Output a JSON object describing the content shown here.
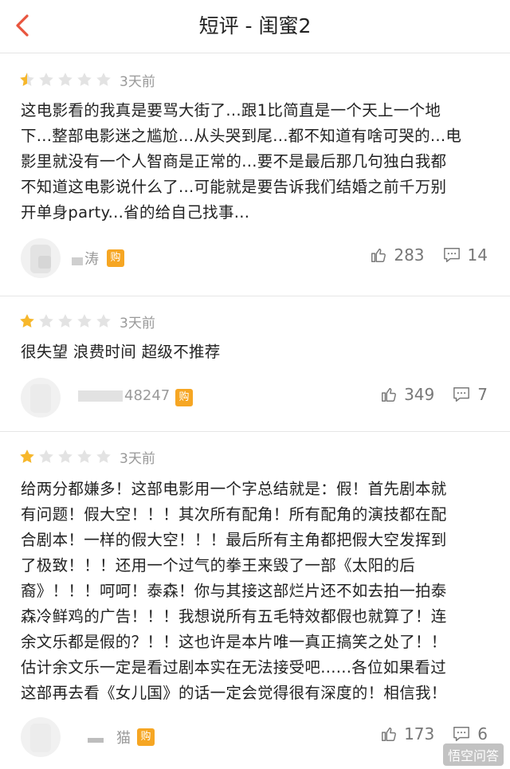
{
  "header": {
    "title": "短评 - 闺蜜2",
    "back_icon": "chevron-left-icon",
    "accent": "#e8553e"
  },
  "star_colors": {
    "filled": "#f7b72a",
    "empty": "#e3e3e3"
  },
  "reviews": [
    {
      "rating": 0.5,
      "time": "3天前",
      "lines": [
        "这电影看的我真是要骂大街了...跟1比简直是一个天上一个地",
        "下...整部电影迷之尴尬...从头哭到尾...都不知道有啥可哭的...电",
        "影里就没有一个人智商是正常的...要不是最后那几句独白我都",
        "不知道这电影说什么了...可能就是要告诉我们结婚之前千万别",
        "开单身party...省的给自己找事..."
      ],
      "username": "涛",
      "badge": "购",
      "likes": "283",
      "comments": "14"
    },
    {
      "rating": 1,
      "time": "3天前",
      "lines": [
        "很失望 浪费时间 超级不推荐"
      ],
      "username": "48247",
      "badge": "购",
      "likes": "349",
      "comments": "7"
    },
    {
      "rating": 1,
      "time": "3天前",
      "lines": [
        "给两分都嫌多！这部电影用一个字总结就是：假！首先剧本就",
        "有问题！假大空！！！其次所有配角！所有配角的演技都在配",
        "合剧本！一样的假大空！！！最后所有主角都把假大空发挥到",
        "了极致！！！还用一个过气的拳王来毁了一部《太阳的后",
        "裔》！！！呵呵！泰森！你与其接这部烂片还不如去拍一拍泰",
        "森冷鲜鸡的广告！！！我想说所有五毛特效都假也就算了！连",
        "余文乐都是假的？！！这也许是本片唯一真正搞笑之处了！！",
        "估计余文乐一定是看过剧本实在无法接受吧......各位如果看过",
        "这部再去看《女儿国》的话一定会觉得很有深度的！相信我！"
      ],
      "username": "猫",
      "badge": "购",
      "likes": "173",
      "comments": "6"
    }
  ],
  "watermark": "悟空问答"
}
